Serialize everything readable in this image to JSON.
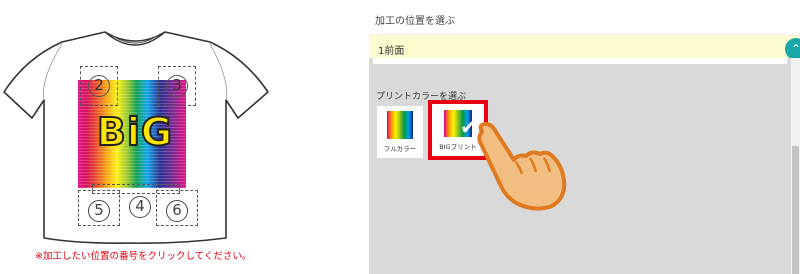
{
  "shirt": {
    "zones": [
      {
        "id": "zone-2",
        "num": "2"
      },
      {
        "id": "zone-3",
        "num": "3"
      },
      {
        "id": "zone-4",
        "num": "4"
      },
      {
        "id": "zone-5",
        "num": "5"
      },
      {
        "id": "zone-6",
        "num": "6"
      }
    ],
    "big_text": "BiG",
    "instruction": "※加工したい位置の番号をクリックしてください。"
  },
  "panel": {
    "section_title": "加工の位置を選ぶ",
    "accordion_label": "1前面",
    "accordion_toggle": "⌃",
    "color_title": "プリントカラーを選ぶ",
    "options": [
      {
        "label": "フルカラー",
        "selected": false
      },
      {
        "label": "BIGプリント",
        "selected": true
      }
    ]
  },
  "colors": {
    "accent": "#1ba6a8",
    "selection": "#e60012",
    "accordion_bg": "#fdfbd0",
    "instruction": "#e60012"
  }
}
